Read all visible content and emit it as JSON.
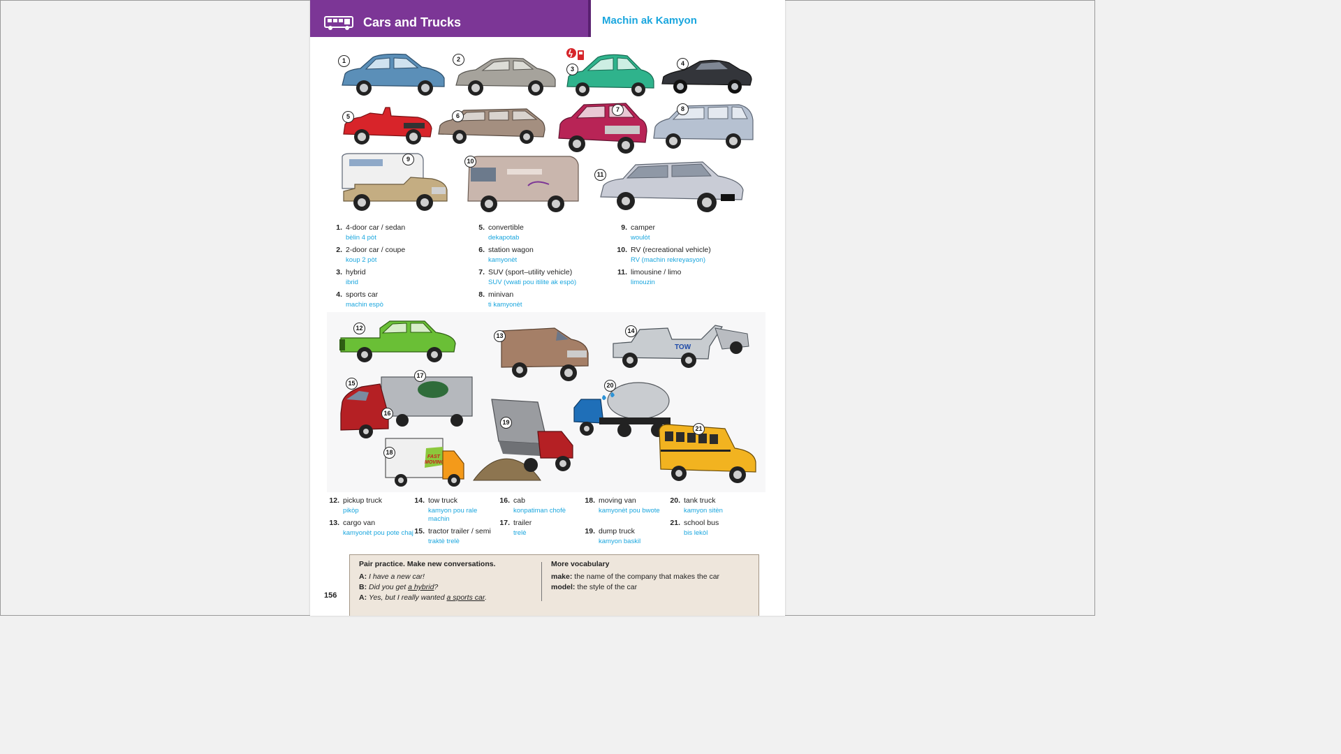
{
  "header": {
    "title": "Cars and Trucks",
    "subtitle": "Machin ak Kamyon"
  },
  "vehicles": [
    {
      "num": "1",
      "color": "#5b8fb8"
    },
    {
      "num": "2",
      "color": "#a6a39c"
    },
    {
      "num": "3",
      "color": "#2fb38c"
    },
    {
      "num": "4",
      "color": "#33353a"
    },
    {
      "num": "5",
      "color": "#d8242a"
    },
    {
      "num": "6",
      "color": "#a48f80"
    },
    {
      "num": "7",
      "color": "#b82456"
    },
    {
      "num": "8",
      "color": "#b6c1d1"
    },
    {
      "num": "9",
      "color": "#c4ad82"
    },
    {
      "num": "10",
      "color": "#c9b6ad"
    },
    {
      "num": "11",
      "color": "#c9ccd6"
    },
    {
      "num": "12",
      "color": "#6abf36"
    },
    {
      "num": "13",
      "color": "#a57f67"
    },
    {
      "num": "14",
      "color": "#c8ccd0"
    },
    {
      "num": "15",
      "color": "#b52024"
    },
    {
      "num": "16",
      "color": "#b52024"
    },
    {
      "num": "17",
      "color": "#b5b8bd"
    },
    {
      "num": "18",
      "color": "#f0f0f0"
    },
    {
      "num": "19",
      "color": "#9a9ca0"
    },
    {
      "num": "20",
      "color": "#1f6fb8"
    },
    {
      "num": "21",
      "color": "#f2b320"
    }
  ],
  "vocab": [
    {
      "n": "1.",
      "en": "4-door car / sedan",
      "ht": "bèlin 4 pòt"
    },
    {
      "n": "2.",
      "en": "2-door car / coupe",
      "ht": "koup 2 pòt"
    },
    {
      "n": "3.",
      "en": "hybrid",
      "ht": "ibrid"
    },
    {
      "n": "4.",
      "en": "sports car",
      "ht": "machin espò"
    },
    {
      "n": "5.",
      "en": "convertible",
      "ht": "dekapotab"
    },
    {
      "n": "6.",
      "en": "station wagon",
      "ht": "kamyonèt"
    },
    {
      "n": "7.",
      "en": "SUV (sport–utility vehicle)",
      "ht": "SUV (vwati pou itilite ak espò)"
    },
    {
      "n": "8.",
      "en": "minivan",
      "ht": "ti kamyonèt"
    },
    {
      "n": "9.",
      "en": "camper",
      "ht": "woulòt"
    },
    {
      "n": "10.",
      "en": "RV (recreational vehicle)",
      "ht": "RV (machin rekreyasyon)"
    },
    {
      "n": "11.",
      "en": "limousine / limo",
      "ht": "limouzin"
    },
    {
      "n": "12.",
      "en": "pickup truck",
      "ht": "pikòp"
    },
    {
      "n": "13.",
      "en": "cargo van",
      "ht": "kamyonèt pou pote chaj"
    },
    {
      "n": "14.",
      "en": "tow truck",
      "ht": "kamyon pou rale machin"
    },
    {
      "n": "15.",
      "en": "tractor trailer / semi",
      "ht": "traktè trelè"
    },
    {
      "n": "16.",
      "en": "cab",
      "ht": "konpatiman chofè"
    },
    {
      "n": "17.",
      "en": "trailer",
      "ht": "trelè"
    },
    {
      "n": "18.",
      "en": "moving van",
      "ht": "kamyonèt pou bwote"
    },
    {
      "n": "19.",
      "en": "dump truck",
      "ht": "kamyon baskil"
    },
    {
      "n": "20.",
      "en": "tank truck",
      "ht": "kamyon sitèn"
    },
    {
      "n": "21.",
      "en": "school bus",
      "ht": "bis lekòl"
    }
  ],
  "practice": {
    "heading": "Pair practice. Make new conversations.",
    "a1_speaker": "A:",
    "a1_text": "I have a new car!",
    "b_speaker": "B:",
    "b_text_pre": "Did you get ",
    "b_text_u": "a hybrid",
    "b_text_post": "?",
    "a2_speaker": "A:",
    "a2_text_pre": "Yes, but I really wanted ",
    "a2_text_u": "a sports car",
    "a2_text_post": "."
  },
  "more_vocab": {
    "heading": "More vocabulary",
    "make_term": "make:",
    "make_def": " the name of the company that makes the car",
    "model_term": "model:",
    "model_def": " the style of the car"
  },
  "page_number": "156",
  "truck_signs": {
    "tow": "TOW",
    "moving_1": "FAST",
    "moving_2": "MOVING"
  }
}
